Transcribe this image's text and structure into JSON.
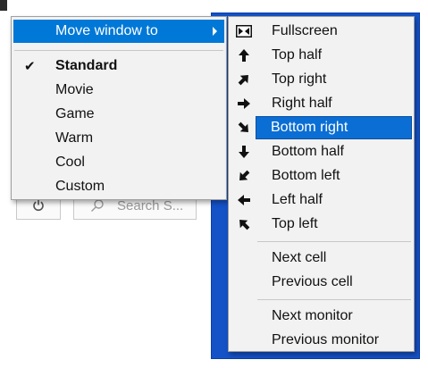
{
  "background": {
    "search_placeholder": "Search S..."
  },
  "context_menu": {
    "move_window_label": "Move window to",
    "check_mark": "✔",
    "profiles": [
      {
        "label": "Standard",
        "checked": true
      },
      {
        "label": "Movie",
        "checked": false
      },
      {
        "label": "Game",
        "checked": false
      },
      {
        "label": "Warm",
        "checked": false
      },
      {
        "label": "Cool",
        "checked": false
      },
      {
        "label": "Custom",
        "checked": false
      }
    ]
  },
  "move_submenu": {
    "positions": [
      {
        "label": "Fullscreen",
        "icon": "fullscreen-icon"
      },
      {
        "label": "Top half",
        "icon": "arrow-up-icon"
      },
      {
        "label": "Top right",
        "icon": "arrow-up-right-icon"
      },
      {
        "label": "Right half",
        "icon": "arrow-right-icon"
      },
      {
        "label": "Bottom right",
        "icon": "arrow-down-right-icon",
        "highlighted": true
      },
      {
        "label": "Bottom half",
        "icon": "arrow-down-icon"
      },
      {
        "label": "Bottom left",
        "icon": "arrow-down-left-icon"
      },
      {
        "label": "Left half",
        "icon": "arrow-left-icon"
      },
      {
        "label": "Top left",
        "icon": "arrow-up-left-icon"
      }
    ],
    "cells": [
      {
        "label": "Next cell"
      },
      {
        "label": "Previous cell"
      }
    ],
    "monitors": [
      {
        "label": "Next monitor"
      },
      {
        "label": "Previous monitor"
      }
    ]
  },
  "colors": {
    "highlight": "#0078d7",
    "window_blue": "#1452c8",
    "menu_bg": "#f2f2f2"
  }
}
